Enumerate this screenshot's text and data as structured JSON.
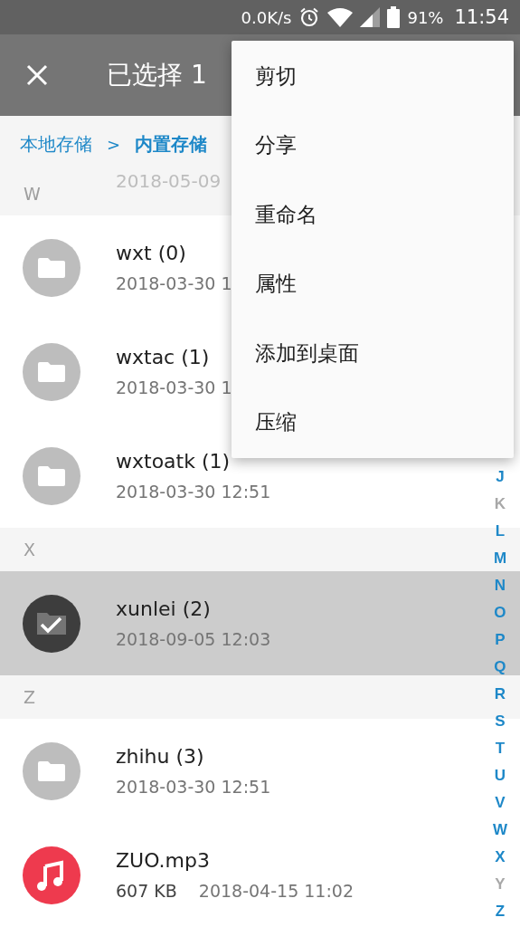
{
  "status_bar": {
    "speed": "0.0K/s",
    "battery": "91%",
    "time": "11:54"
  },
  "app_bar": {
    "title": "已选择 1"
  },
  "breadcrumb": [
    {
      "label": "本地存储"
    },
    {
      "label": "内置存储"
    }
  ],
  "breadcrumb_separator": ">",
  "ghost_row": {
    "date": "2018-05-09"
  },
  "sections": [
    {
      "letter": "W",
      "items": [
        {
          "kind": "folder",
          "name": "wxt (0)",
          "date": "2018-03-30 1",
          "selected": false
        },
        {
          "kind": "folder",
          "name": "wxtac (1)",
          "date": "2018-03-30 1",
          "selected": false
        },
        {
          "kind": "folder",
          "name": "wxtoatk (1)",
          "date": "2018-03-30 12:51",
          "selected": false
        }
      ]
    },
    {
      "letter": "X",
      "items": [
        {
          "kind": "folder",
          "name": "xunlei (2)",
          "date": "2018-09-05 12:03",
          "selected": true
        }
      ]
    },
    {
      "letter": "Z",
      "items": [
        {
          "kind": "folder",
          "name": "zhihu (3)",
          "date": "2018-03-30 12:51",
          "selected": false
        },
        {
          "kind": "music",
          "name": "ZUO.mp3",
          "size": "607 KB",
          "date": "2018-04-15 11:02",
          "selected": false
        }
      ]
    }
  ],
  "index_letters": [
    {
      "label": "J",
      "disabled": false
    },
    {
      "label": "K",
      "disabled": true
    },
    {
      "label": "L",
      "disabled": false
    },
    {
      "label": "M",
      "disabled": false
    },
    {
      "label": "N",
      "disabled": false
    },
    {
      "label": "O",
      "disabled": false
    },
    {
      "label": "P",
      "disabled": false
    },
    {
      "label": "Q",
      "disabled": false
    },
    {
      "label": "R",
      "disabled": false
    },
    {
      "label": "S",
      "disabled": false
    },
    {
      "label": "T",
      "disabled": false
    },
    {
      "label": "U",
      "disabled": false
    },
    {
      "label": "V",
      "disabled": false
    },
    {
      "label": "W",
      "disabled": false
    },
    {
      "label": "X",
      "disabled": false
    },
    {
      "label": "Y",
      "disabled": true
    },
    {
      "label": "Z",
      "disabled": false
    }
  ],
  "menu": [
    {
      "label": "剪切"
    },
    {
      "label": "分享"
    },
    {
      "label": "重命名"
    },
    {
      "label": "属性"
    },
    {
      "label": "添加到桌面"
    },
    {
      "label": "压缩"
    }
  ]
}
